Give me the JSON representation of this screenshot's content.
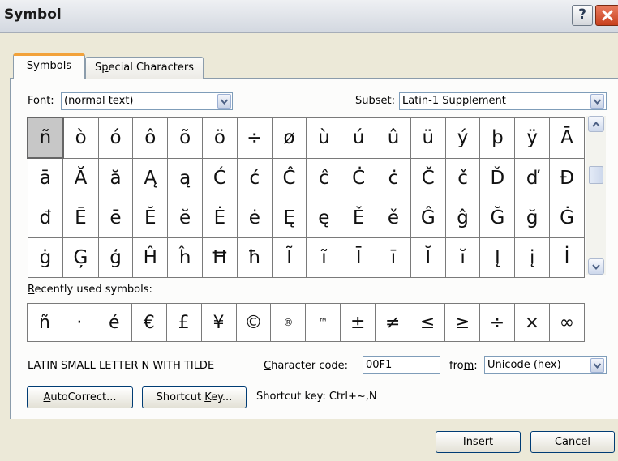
{
  "window": {
    "title": "Symbol",
    "help_label": "?"
  },
  "tabs": [
    {
      "label_prefix": "",
      "mnemonic": "S",
      "label_rest": "ymbols"
    },
    {
      "label_prefix": "S",
      "mnemonic": "p",
      "label_rest": "ecial Characters"
    }
  ],
  "font": {
    "label_mnemonic": "F",
    "label_rest": "ont:",
    "value": "(normal text)"
  },
  "subset": {
    "label_prefix": "S",
    "label_mnemonic": "u",
    "label_rest": "bset:",
    "value": "Latin-1 Supplement"
  },
  "symbols": [
    [
      "ñ",
      "ò",
      "ó",
      "ô",
      "õ",
      "ö",
      "÷",
      "ø",
      "ù",
      "ú",
      "û",
      "ü",
      "ý",
      "þ",
      "ÿ",
      "Ā"
    ],
    [
      "ā",
      "Ă",
      "ă",
      "Ą",
      "ą",
      "Ć",
      "ć",
      "Ĉ",
      "ĉ",
      "Ċ",
      "ċ",
      "Č",
      "č",
      "Ď",
      "ď",
      "Đ"
    ],
    [
      "đ",
      "Ē",
      "ē",
      "Ĕ",
      "ĕ",
      "Ė",
      "ė",
      "Ę",
      "ę",
      "Ě",
      "ě",
      "Ĝ",
      "ĝ",
      "Ğ",
      "ğ",
      "Ġ"
    ],
    [
      "ġ",
      "Ģ",
      "ģ",
      "Ĥ",
      "ĥ",
      "Ħ",
      "ħ",
      "Ĩ",
      "ĩ",
      "Ī",
      "ī",
      "Ĭ",
      "ĭ",
      "Į",
      "į",
      "İ"
    ]
  ],
  "recent": {
    "label_mnemonic": "R",
    "label_rest": "ecently used symbols:",
    "items": [
      "ñ",
      "·",
      "é",
      "€",
      "£",
      "¥",
      "©",
      "®",
      "™",
      "±",
      "≠",
      "≤",
      "≥",
      "÷",
      "×",
      "∞"
    ]
  },
  "char_name": "LATIN SMALL LETTER N WITH TILDE",
  "char_code": {
    "label_mnemonic": "C",
    "label_rest": "haracter code:",
    "value": "00F1"
  },
  "from": {
    "label_prefix": "fro",
    "label_mnemonic": "m",
    "label_rest": ":",
    "value": "Unicode (hex)"
  },
  "buttons": {
    "autocorrect": {
      "mnemonic": "A",
      "rest": "utoCorrect..."
    },
    "shortcut_key": {
      "prefix": "Shortcut ",
      "mnemonic": "K",
      "rest": "ey..."
    },
    "insert": {
      "mnemonic": "I",
      "rest": "nsert"
    },
    "cancel": "Cancel"
  },
  "shortcut_text": "Shortcut key: Ctrl+~,N"
}
